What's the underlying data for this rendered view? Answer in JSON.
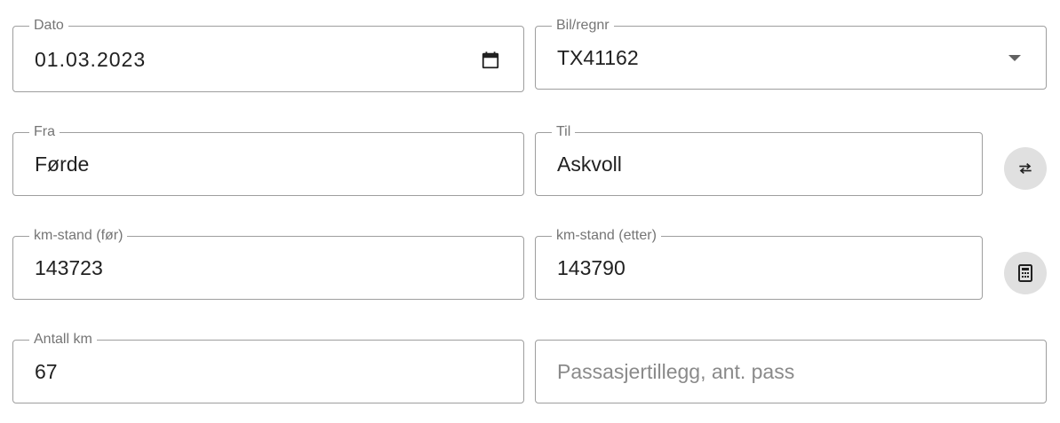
{
  "fields": {
    "dato": {
      "label": "Dato",
      "value": "01.03.2023"
    },
    "bil": {
      "label": "Bil/regnr",
      "value": "TX41162"
    },
    "fra": {
      "label": "Fra",
      "value": "Førde"
    },
    "til": {
      "label": "Til",
      "value": "Askvoll"
    },
    "km_for": {
      "label": "km-stand (før)",
      "value": "143723"
    },
    "km_etter": {
      "label": "km-stand (etter)",
      "value": "143790"
    },
    "antall_km": {
      "label": "Antall km",
      "value": "67"
    },
    "passasjer": {
      "placeholder": "Passasjertillegg, ant. pass",
      "value": ""
    }
  },
  "icons": {
    "date": "calendar-icon",
    "select": "chevron-down-icon",
    "swap": "swap-icon",
    "calculate": "calculator-icon"
  },
  "colors": {
    "border": "#9e9e9e",
    "label": "#757575",
    "text": "#212121",
    "button_bg": "#e0e0e0"
  }
}
